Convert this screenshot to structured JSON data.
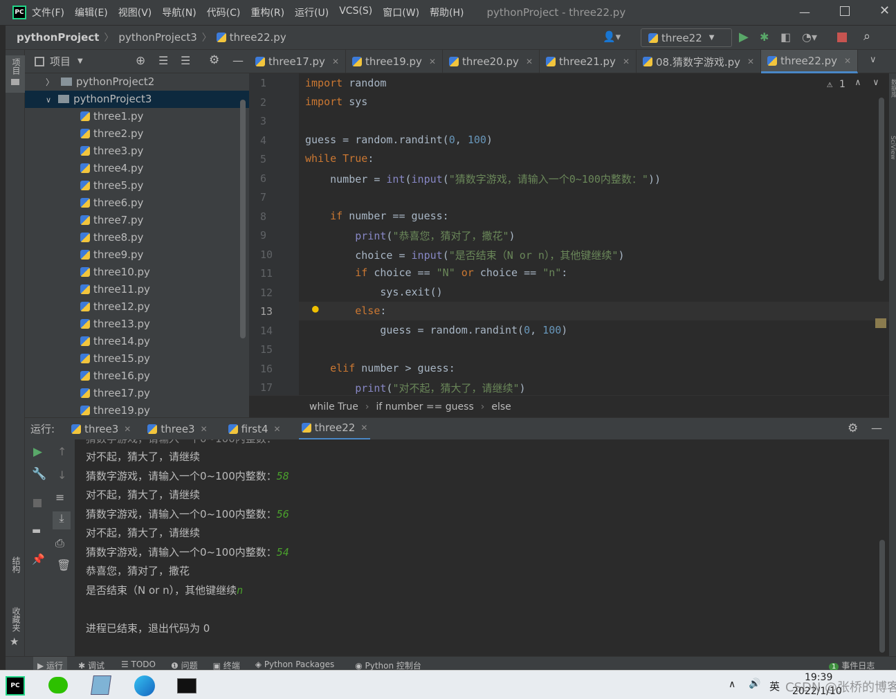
{
  "title_bar": {
    "menus": [
      "文件(F)",
      "编辑(E)",
      "视图(V)",
      "导航(N)",
      "代码(C)",
      "重构(R)",
      "运行(U)",
      "VCS(S)",
      "窗口(W)",
      "帮助(H)"
    ],
    "window_title": "pythonProject - three22.py"
  },
  "nav": {
    "crumbs": [
      "pythonProject",
      "pythonProject3",
      "three22.py"
    ],
    "run_config": "three22"
  },
  "left_tools": {
    "project": "项目",
    "structure": "结构",
    "favorites": "收藏夹"
  },
  "project_panel": {
    "title": "项目",
    "folders": [
      "pythonProject2",
      "pythonProject3"
    ],
    "files": [
      "three1.py",
      "three2.py",
      "three3.py",
      "three4.py",
      "three5.py",
      "three6.py",
      "three7.py",
      "three8.py",
      "three9.py",
      "three10.py",
      "three11.py",
      "three12.py",
      "three13.py",
      "three14.py",
      "three15.py",
      "three16.py",
      "three17.py",
      "three19.py"
    ]
  },
  "editor_tabs": [
    "three17.py",
    "three19.py",
    "three20.py",
    "three21.py",
    "08.猜数字游戏.py",
    "three22.py"
  ],
  "editor": {
    "warning_count": "1",
    "current_line": 13,
    "line_numbers": [
      "1",
      "2",
      "3",
      "4",
      "5",
      "6",
      "7",
      "8",
      "9",
      "10",
      "11",
      "12",
      "13",
      "14",
      "15",
      "16",
      "17"
    ]
  },
  "breadcrumb": [
    "while True",
    "if number == guess",
    "else"
  ],
  "run_panel": {
    "label": "运行:",
    "tabs": [
      "three3",
      "three3",
      "first4",
      "three22"
    ]
  },
  "console": {
    "lines": [
      {
        "text": "对不起，猜大了，请继续",
        "input": ""
      },
      {
        "text": "猜数字游戏，请输入一个0~100内整数：",
        "input": "58"
      },
      {
        "text": "对不起，猜大了，请继续",
        "input": ""
      },
      {
        "text": "猜数字游戏，请输入一个0~100内整数：",
        "input": "56"
      },
      {
        "text": "对不起，猜大了，请继续",
        "input": ""
      },
      {
        "text": "猜数字游戏，请输入一个0~100内整数：",
        "input": "54"
      },
      {
        "text": "恭喜您，猜对了，撒花",
        "input": ""
      },
      {
        "text": "是否结束（N or n），其他键继续",
        "input": "n"
      },
      {
        "text": "",
        "input": ""
      },
      {
        "text": "进程已结束，退出代码为 0",
        "input": ""
      }
    ]
  },
  "bottom_tools": [
    "运行",
    "调试",
    "TODO",
    "问题",
    "终端",
    "Python Packages",
    "Python 控制台",
    "事件日志"
  ],
  "event_count": "1",
  "right_tools": {
    "database": "数据库",
    "sciview": "SciView"
  },
  "taskbar": {
    "lang": "英",
    "time": "19:39",
    "date": "2022/1/10",
    "watermark": "CSDN @张桥的博客"
  }
}
